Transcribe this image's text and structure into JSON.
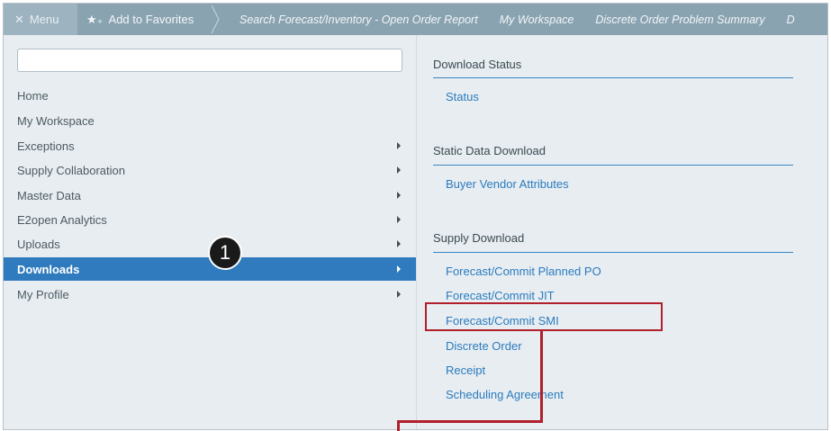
{
  "topbar": {
    "menu_label": "Menu",
    "favorites_label": "Add to Favorites",
    "breadcrumbs": [
      "Search Forecast/Inventory - Open Order Report",
      "My Workspace",
      "Discrete Order Problem Summary",
      "D"
    ]
  },
  "search": {
    "placeholder": ""
  },
  "nav": [
    {
      "label": "Home",
      "has_submenu": false
    },
    {
      "label": "My Workspace",
      "has_submenu": false
    },
    {
      "label": "Exceptions",
      "has_submenu": true
    },
    {
      "label": "Supply Collaboration",
      "has_submenu": true
    },
    {
      "label": "Master Data",
      "has_submenu": true
    },
    {
      "label": "E2open Analytics",
      "has_submenu": true
    },
    {
      "label": "Uploads",
      "has_submenu": true
    },
    {
      "label": "Downloads",
      "has_submenu": true,
      "active": true
    },
    {
      "label": "My Profile",
      "has_submenu": true
    }
  ],
  "callout": {
    "label": "1"
  },
  "panel": {
    "sections": [
      {
        "title": "Download Status",
        "links": [
          "Status"
        ]
      },
      {
        "title": "Static Data Download",
        "links": [
          "Buyer Vendor Attributes"
        ]
      },
      {
        "title": "Supply Download",
        "links": [
          "Forecast/Commit Planned PO",
          "Forecast/Commit JIT",
          "Forecast/Commit SMI",
          "Discrete Order",
          "Receipt",
          "Scheduling Agreement"
        ]
      }
    ]
  },
  "colors": {
    "topbar": "#8aa3b1",
    "active": "#2f7bbd",
    "link": "#2c7bbf",
    "highlight": "#b01f2b"
  }
}
